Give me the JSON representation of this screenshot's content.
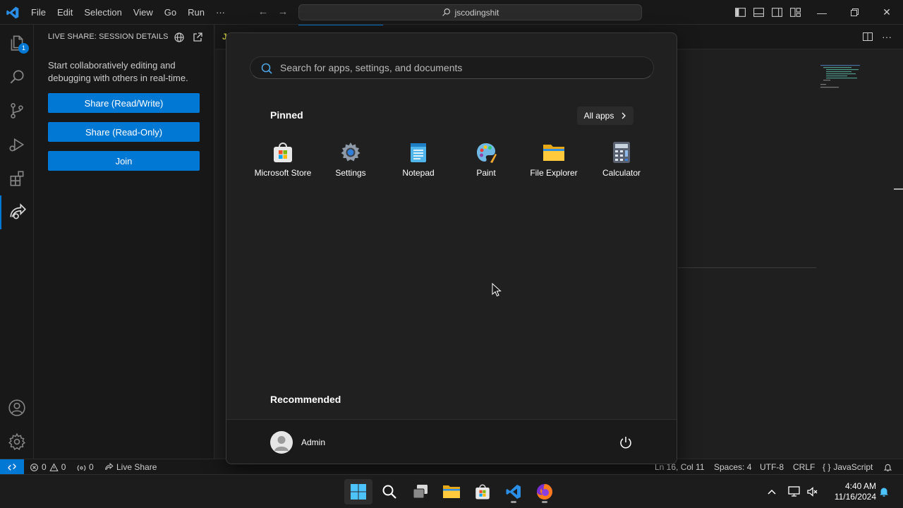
{
  "titlebar": {
    "menu": [
      "File",
      "Edit",
      "Selection",
      "View",
      "Go",
      "Run",
      "···"
    ],
    "search_text": "jscodingshit"
  },
  "activitybar": {
    "explorer_badge": "1"
  },
  "sidebar": {
    "title": "LIVE SHARE: SESSION DETAILS",
    "description": "Start collaboratively editing and debugging with others in real-time.",
    "buttons": {
      "share_rw": "Share (Read/Write)",
      "share_ro": "Share (Read-Only)",
      "join": "Join"
    }
  },
  "editor": {
    "tab_icon_text": "J"
  },
  "statusbar": {
    "errors": "0",
    "warnings": "0",
    "ports": "0",
    "live_share": "Live Share",
    "position": "Ln 16, Col 11",
    "spaces": "Spaces: 4",
    "encoding": "UTF-8",
    "eol": "CRLF",
    "language": "JavaScript"
  },
  "startmenu": {
    "search_placeholder": "Search for apps, settings, and documents",
    "pinned_label": "Pinned",
    "all_apps_label": "All apps",
    "pinned_apps": [
      {
        "name": "Microsoft Store",
        "icon": "store-icon"
      },
      {
        "name": "Settings",
        "icon": "settings-icon"
      },
      {
        "name": "Notepad",
        "icon": "notepad-icon"
      },
      {
        "name": "Paint",
        "icon": "paint-icon"
      },
      {
        "name": "File Explorer",
        "icon": "folder-icon"
      },
      {
        "name": "Calculator",
        "icon": "calculator-icon"
      }
    ],
    "recommended_label": "Recommended",
    "user_name": "Admin"
  },
  "taskbar": {
    "time": "4:40 AM",
    "date": "11/16/2024"
  },
  "colors": {
    "accent": "#0078d4",
    "vsc_bg": "#1f1f1f",
    "start_bg": "#202020"
  }
}
